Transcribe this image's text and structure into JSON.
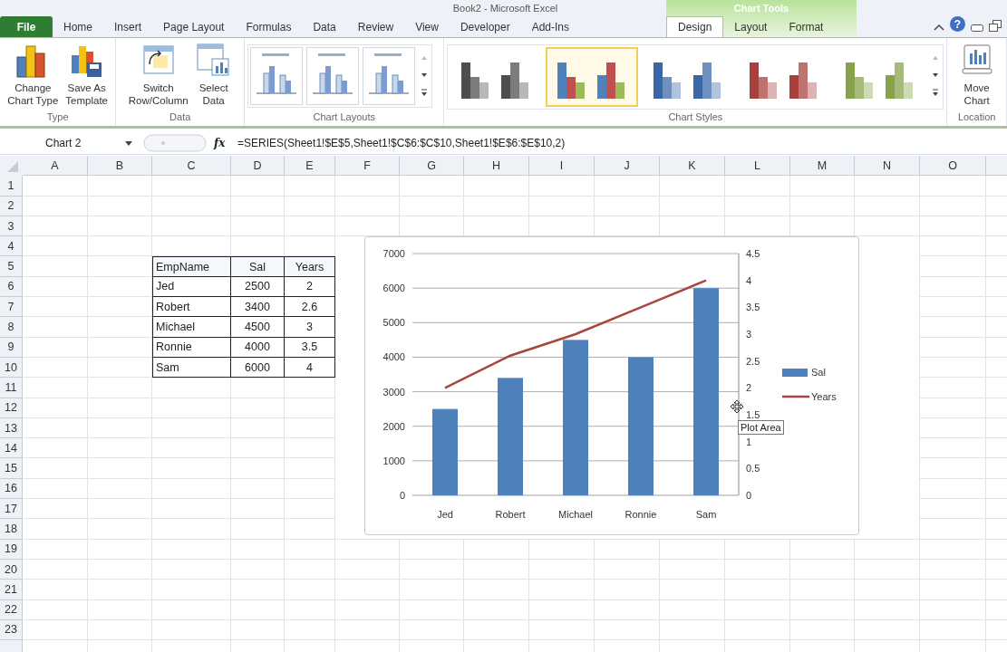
{
  "window": {
    "title": "Book2 - Microsoft Excel",
    "context_label": "Chart Tools",
    "help_glyph": "?"
  },
  "tabs": [
    {
      "label": "File",
      "kind": "file",
      "selected": false
    },
    {
      "label": "Home",
      "kind": "normal",
      "selected": false
    },
    {
      "label": "Insert",
      "kind": "normal",
      "selected": false
    },
    {
      "label": "Page Layout",
      "kind": "normal",
      "selected": false
    },
    {
      "label": "Formulas",
      "kind": "normal",
      "selected": false
    },
    {
      "label": "Data",
      "kind": "normal",
      "selected": false
    },
    {
      "label": "Review",
      "kind": "normal",
      "selected": false
    },
    {
      "label": "View",
      "kind": "normal",
      "selected": false
    },
    {
      "label": "Developer",
      "kind": "normal",
      "selected": false
    },
    {
      "label": "Add-Ins",
      "kind": "normal",
      "selected": false
    },
    {
      "label": "Design",
      "kind": "context",
      "selected": true
    },
    {
      "label": "Layout",
      "kind": "context",
      "selected": false
    },
    {
      "label": "Format",
      "kind": "context",
      "selected": false
    }
  ],
  "ribbon": {
    "groups": [
      {
        "label": "Type",
        "kind": "buttons",
        "buttons": [
          {
            "label": "Change\nChart Type",
            "kind": "chart-type"
          },
          {
            "label": "Save As\nTemplate",
            "kind": "template"
          }
        ]
      },
      {
        "label": "Data",
        "kind": "buttons",
        "buttons": [
          {
            "label": "Switch\nRow/Column",
            "kind": "switch"
          },
          {
            "label": "Select\nData",
            "kind": "select-data"
          }
        ]
      },
      {
        "label": "Chart Layouts",
        "kind": "layouts",
        "layouts": [
          {
            "selected": false
          },
          {
            "selected": false
          },
          {
            "selected": false
          }
        ]
      },
      {
        "label": "Chart Styles",
        "kind": "styles",
        "styles": [
          {
            "selected": false,
            "kind": "mono",
            "color": "#4d4d4d"
          },
          {
            "selected": true,
            "kind": "multi"
          },
          {
            "selected": false,
            "kind": "mono",
            "color": "#3a67a8"
          },
          {
            "selected": false,
            "kind": "mono",
            "color": "#a8403c"
          },
          {
            "selected": false,
            "kind": "mono",
            "color": "#86a24a"
          }
        ]
      },
      {
        "label": "Location",
        "kind": "buttons",
        "buttons": [
          {
            "label": "Move\nChart",
            "kind": "move-chart"
          }
        ]
      }
    ]
  },
  "formula_bar": {
    "name_box": "Chart 2",
    "function_label": "fx",
    "formula": "=SERIES(Sheet1!$E$5,Sheet1!$C$6:$C$10,Sheet1!$E$6:$E$10,2)"
  },
  "sheet": {
    "columns": [
      "A",
      "B",
      "C",
      "D",
      "E",
      "F",
      "G",
      "H",
      "I",
      "J",
      "K",
      "L",
      "M",
      "N",
      "O"
    ],
    "rows": [
      "1",
      "2",
      "3",
      "4",
      "5",
      "6",
      "7",
      "8",
      "9",
      "10",
      "11",
      "12",
      "13",
      "14",
      "15",
      "16",
      "17",
      "18",
      "19",
      "20",
      "21",
      "22",
      "23"
    ],
    "table": {
      "header": [
        "EmpName",
        "Sal",
        "Years"
      ],
      "rows": [
        [
          "Jed",
          "2500",
          "2"
        ],
        [
          "Robert",
          "3400",
          "2.6"
        ],
        [
          "Michael",
          "4500",
          "3"
        ],
        [
          "Ronnie",
          "4000",
          "3.5"
        ],
        [
          "Sam",
          "6000",
          "4"
        ]
      ]
    }
  },
  "chart": {
    "tooltip": "Plot Area",
    "chart_data": {
      "type": "bar",
      "categories": [
        "Jed",
        "Robert",
        "Michael",
        "Ronnie",
        "Sam"
      ],
      "grid": true,
      "legend": "right",
      "series": [
        {
          "name": "Sal",
          "axis": "y",
          "color": "#4f81bd",
          "values": [
            2500,
            3400,
            4500,
            4000,
            6000
          ]
        },
        {
          "name": "Years",
          "type": "line",
          "axis": "y2",
          "color": "#a9443f",
          "values": [
            2,
            2.6,
            3,
            3.5,
            4
          ]
        }
      ],
      "ylim": [
        0,
        7000
      ],
      "yticks": [
        0,
        1000,
        2000,
        3000,
        4000,
        5000,
        6000,
        7000
      ],
      "y2lim": [
        0,
        4.5
      ],
      "y2ticks": [
        0,
        0.5,
        1,
        1.5,
        2,
        2.5,
        3,
        3.5,
        4,
        4.5
      ]
    }
  }
}
